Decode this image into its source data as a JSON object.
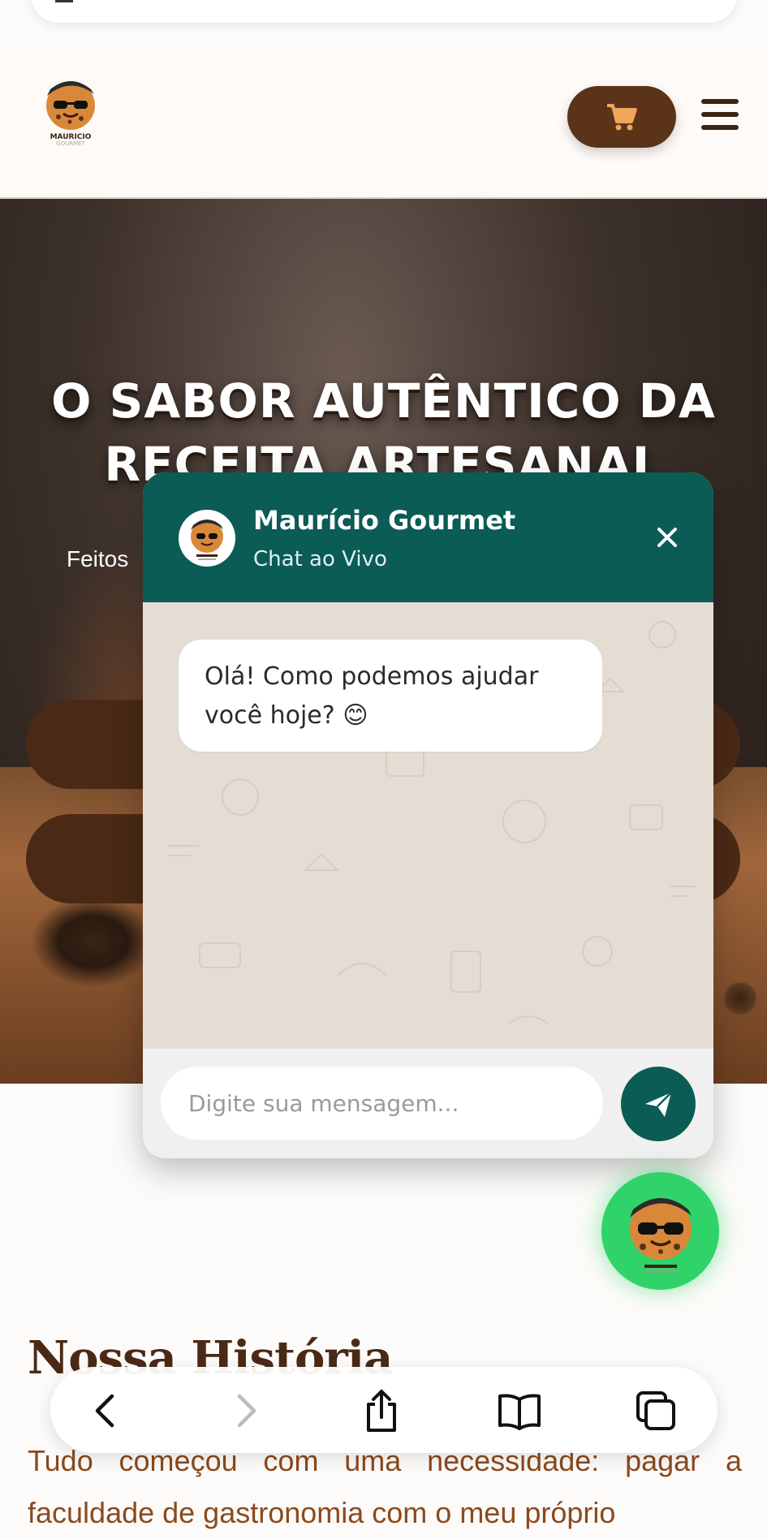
{
  "header": {
    "logo_text": "MAURICIO",
    "logo_subtext": "GOURMET"
  },
  "hero": {
    "title": "O SABOR AUTÊNTICO DA RECEITA ARTESANAL",
    "subtitle": "Feitos"
  },
  "story": {
    "title": "Nossa História",
    "text": "Tudo começou com uma necessidade: pagar a faculdade de gastronomia com o meu próprio"
  },
  "chat": {
    "name": "Maurício Gourmet",
    "status": "Chat ao Vivo",
    "message": "Olá! Como podemos ajudar você hoje? 😊",
    "input_placeholder": "Digite sua mensagem..."
  },
  "colors": {
    "brand_brown": "#5a3319",
    "chat_green": "#0a5c55",
    "fab_green": "#2fd36a",
    "cart_icon": "#f0a65a"
  },
  "icons": [
    "cart-icon",
    "menu-icon",
    "close-icon",
    "send-icon",
    "back-icon",
    "forward-icon",
    "share-icon",
    "bookmarks-icon",
    "tabs-icon"
  ]
}
